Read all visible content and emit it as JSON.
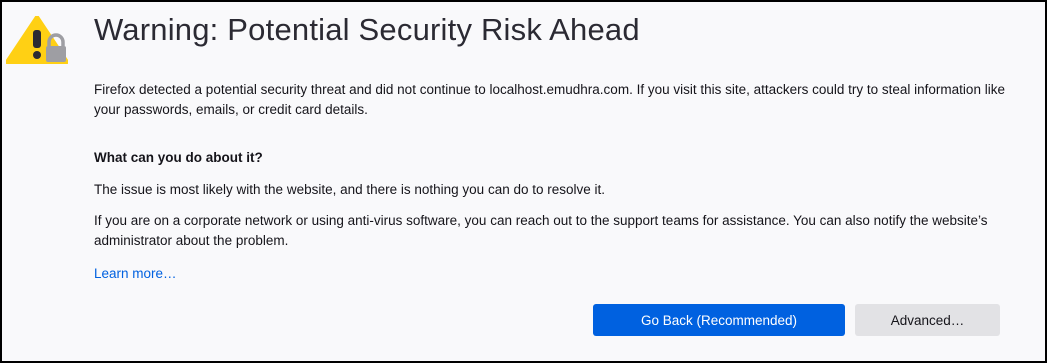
{
  "page": {
    "title": "Warning: Potential Security Risk Ahead",
    "intro": "Firefox detected a potential security threat and did not continue to localhost.emudhra.com. If you visit this site, attackers could try to steal information like your passwords, emails, or credit card details.",
    "what_heading": "What can you do about it?",
    "issue_text": "The issue is most likely with the website, and there is nothing you can do to resolve it.",
    "corporate_text": "If you are on a corporate network or using anti-virus software, you can reach out to the support teams for assistance. You can also notify the website’s administrator about the problem.",
    "learn_more": "Learn more…"
  },
  "buttons": {
    "go_back": "Go Back (Recommended)",
    "advanced": "Advanced…"
  },
  "icons": {
    "warning": "warning-lock-icon"
  },
  "colors": {
    "warning_yellow": "#ffd014",
    "lock_gray": "#9e9ea3",
    "primary_button": "#0061e0",
    "secondary_button": "#e2e2e5",
    "link": "#0061e0"
  }
}
